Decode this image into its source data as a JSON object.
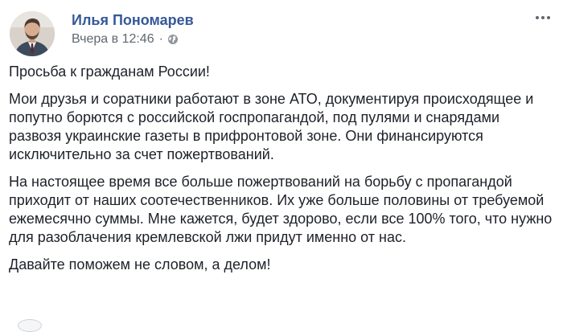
{
  "author": {
    "name": "Илья Пономарев"
  },
  "post_meta": {
    "timestamp": "Вчера в 12:46",
    "separator": "·",
    "privacy_icon": "globe-icon"
  },
  "post": {
    "paragraphs": [
      "Просьба к гражданам России!",
      "Мои друзья и соратники работают в зоне АТО, документируя происходящее и попутно борются с российской госпропагандой, под пулями и снарядами развозя украинские газеты в прифронтовой зоне. Они финансируются исключительно за счет пожертвований.",
      "На настоящее время все больше пожертвований на борьбу с пропагандой приходит от наших соотечественников. Их уже больше половины от требуемой ежемесячно суммы. Мне кажется, будет здорово, если все 100% того, что нужно для разоблачения кремлевской лжи придут именно от нас.",
      "Давайте поможем не словом, а делом!"
    ]
  },
  "colors": {
    "author_link": "#365899",
    "meta_text": "#606770",
    "body_text": "#1d2129",
    "background": "#ffffff"
  },
  "icons": {
    "options": "more-horizontal-icon",
    "avatar": "profile-photo"
  }
}
